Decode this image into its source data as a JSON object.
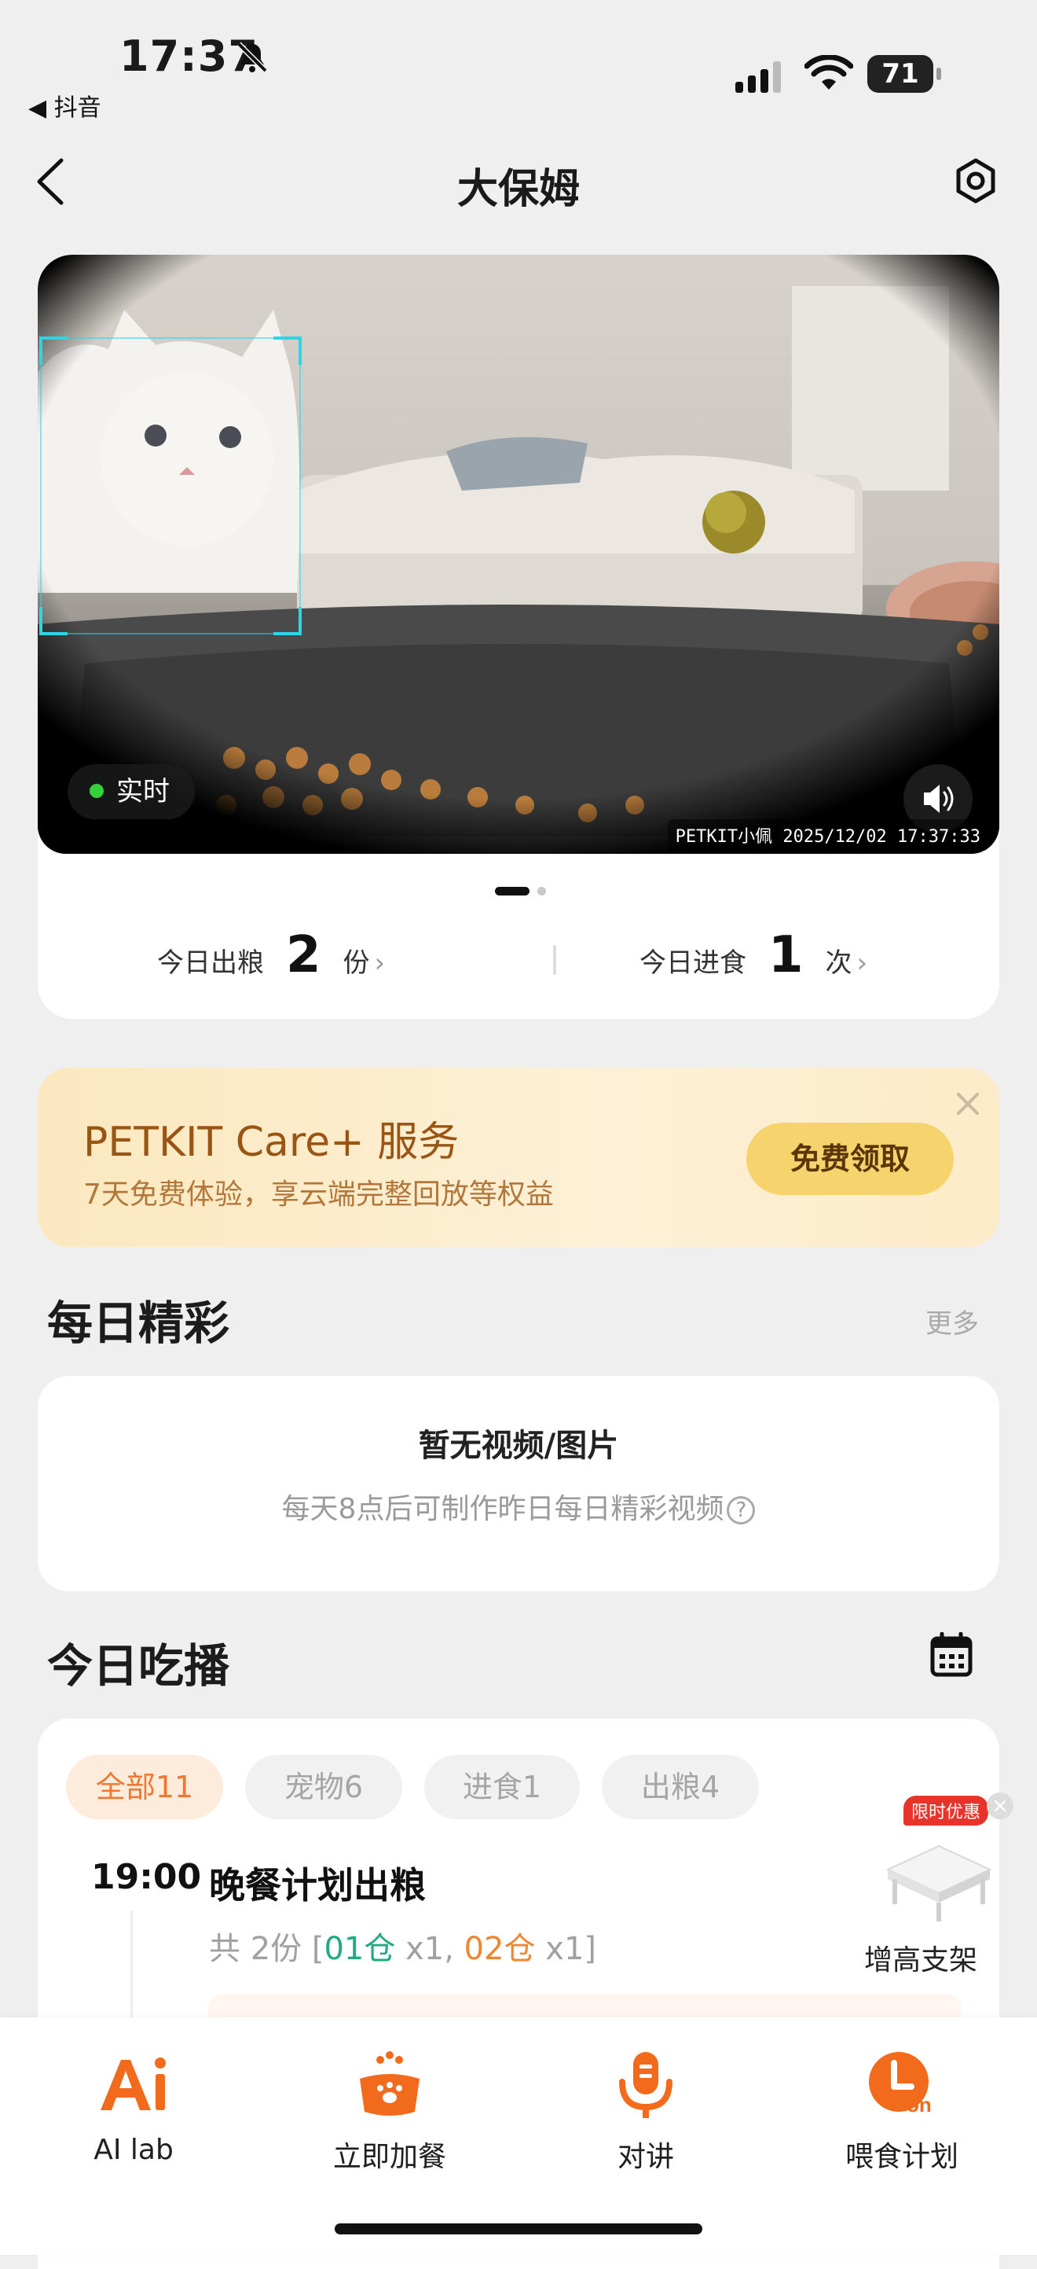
{
  "status_bar": {
    "time": "17:37",
    "back_app": "◀ 抖音",
    "battery": "71"
  },
  "nav": {
    "title": "大保姆"
  },
  "camera": {
    "live_label": "实时",
    "watermark": "PETKIT小佩  2025/12/02  17:37:33",
    "page_index": 1,
    "page_count": 2
  },
  "stats": {
    "dispensed": {
      "label": "今日出粮",
      "value": "2",
      "unit": "份"
    },
    "eaten": {
      "label": "今日进食",
      "value": "1",
      "unit": "次"
    }
  },
  "care_banner": {
    "title": "PETKIT Care+ 服务",
    "subtitle": "7天免费体验，享云端完整回放等权益",
    "button": "免费领取"
  },
  "daily_highlights": {
    "title": "每日精彩",
    "more": "更多",
    "empty_title": "暂无视频/图片",
    "empty_desc": "每天8点后可制作昨日每日精彩视频",
    "help_glyph": "?"
  },
  "feed_log": {
    "title": "今日吃播",
    "filters": [
      "全部11",
      "宠物6",
      "进食1",
      "出粮4"
    ],
    "events": [
      {
        "time": "19:00",
        "title": "晚餐计划出粮",
        "detail_prefix": "共 2份 [",
        "bin1": "01仓",
        "bin1_qty": " x1, ",
        "bin2": "02仓",
        "bin2_qty": " x1]"
      }
    ]
  },
  "promo": {
    "tag": "限时优惠",
    "close": "×",
    "label": "增高支架"
  },
  "tabbar": {
    "items": [
      {
        "label": "AI lab",
        "icon": "ai-lab-icon"
      },
      {
        "label": "立即加餐",
        "icon": "bowl-paw-icon"
      },
      {
        "label": "对讲",
        "icon": "microphone-icon"
      },
      {
        "label": "喂食计划",
        "icon": "schedule-on-icon"
      }
    ],
    "accent": "#f26a1c"
  },
  "colors": {
    "accent": "#f26a1c",
    "live_dot": "#35d13a",
    "teal": "#1eaa83",
    "care_title": "#9a5515"
  }
}
